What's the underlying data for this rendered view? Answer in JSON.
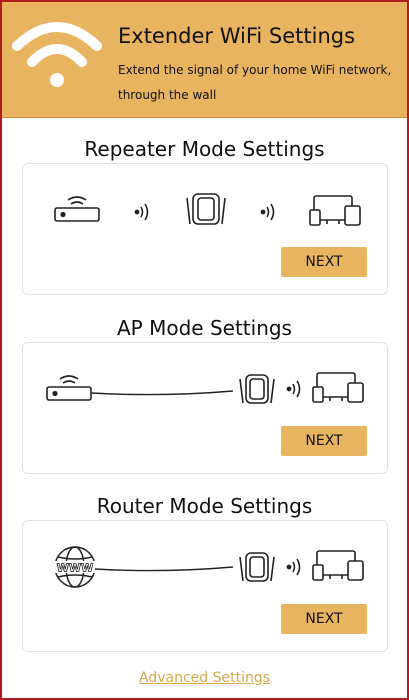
{
  "header": {
    "title": "Extender WiFi Settings",
    "subtitle": "Extend the signal of your home WiFi network, through the wall",
    "logo_icon": "wifi-icon",
    "background": "#e9b45f"
  },
  "sections": [
    {
      "title": "Repeater Mode Settings",
      "button_label": "NEXT",
      "diagram_icons": [
        "router-icon",
        "signal-waves-icon",
        "extender-icon",
        "signal-waves-icon",
        "devices-icon"
      ]
    },
    {
      "title": "AP Mode Settings",
      "button_label": "NEXT",
      "diagram_icons": [
        "router-icon",
        "ethernet-cable-icon",
        "extender-icon",
        "signal-waves-icon",
        "devices-icon"
      ]
    },
    {
      "title": "Router Mode Settings",
      "button_label": "NEXT",
      "diagram_icons": [
        "globe-www-icon",
        "ethernet-cable-icon",
        "extender-icon",
        "signal-waves-icon",
        "devices-icon"
      ]
    }
  ],
  "advanced_link": "Advanced Settings",
  "colors": {
    "accent": "#e9b45f",
    "link": "#d8a84a",
    "frame_border": "#b11c1c"
  }
}
